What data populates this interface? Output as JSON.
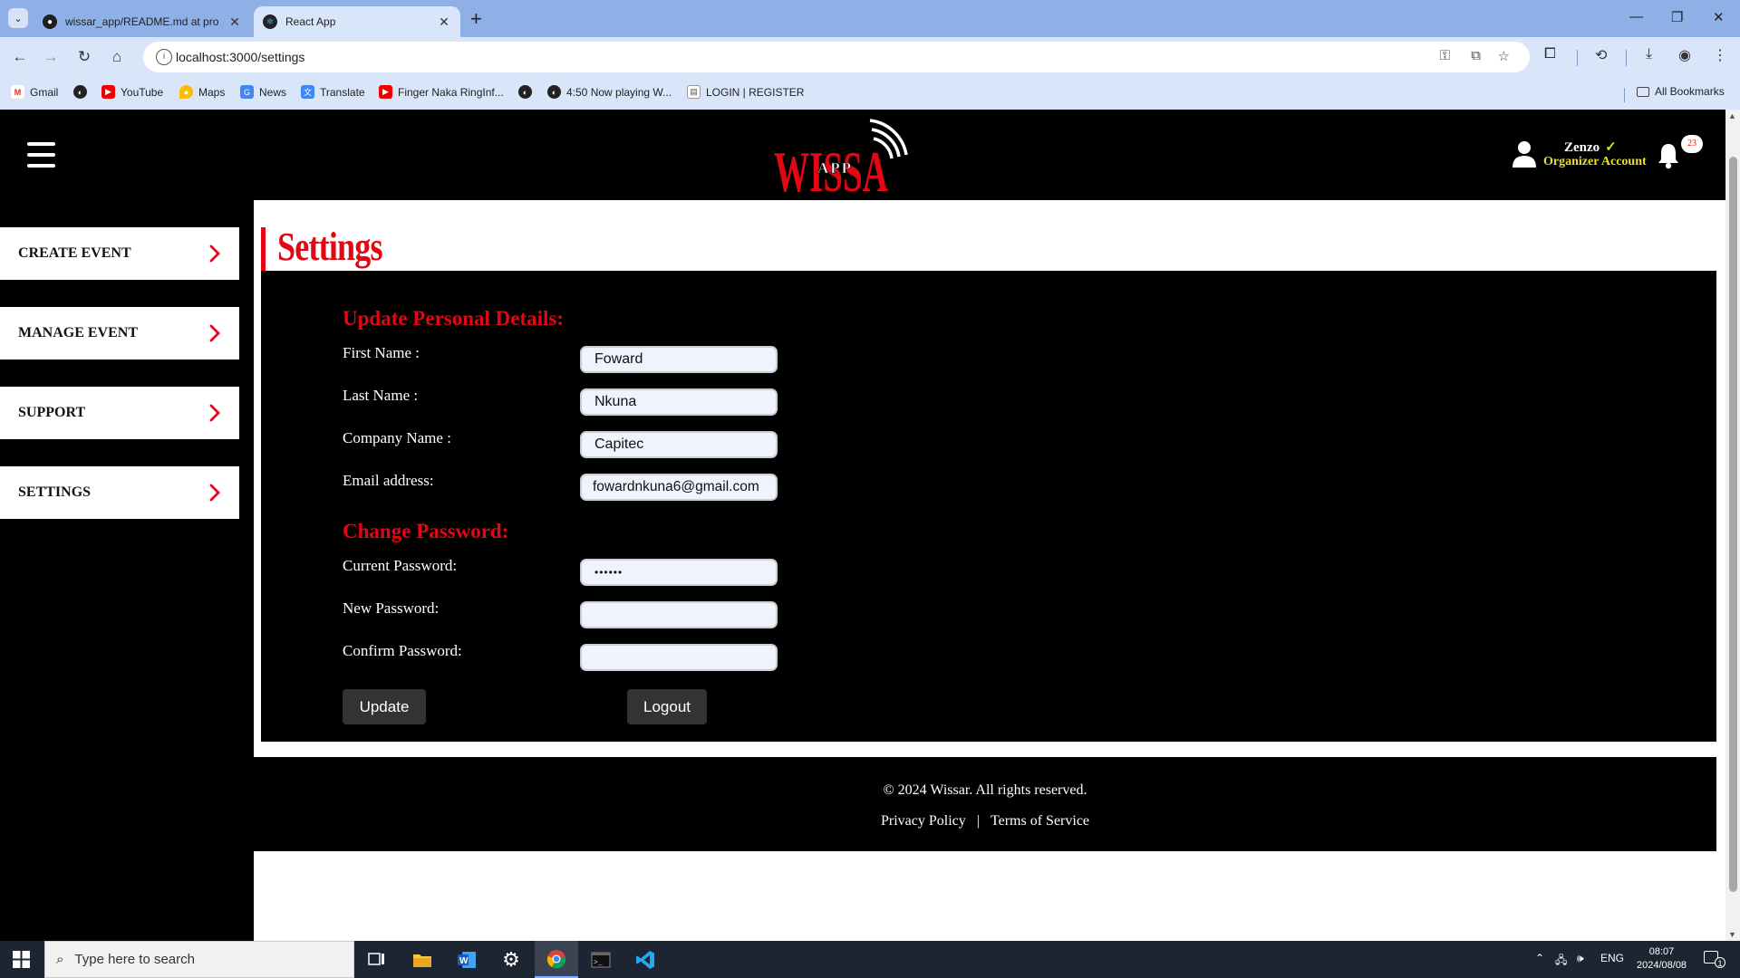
{
  "browser": {
    "tabs": [
      {
        "title": "wissar_app/README.md at pro"
      },
      {
        "title": "React App"
      }
    ],
    "url": "localhost:3000/settings",
    "bookmarks": [
      {
        "label": "Gmail"
      },
      {
        "label": ""
      },
      {
        "label": "YouTube"
      },
      {
        "label": "Maps"
      },
      {
        "label": "News"
      },
      {
        "label": "Translate"
      },
      {
        "label": "Finger Naka RingInf..."
      },
      {
        "label": ""
      },
      {
        "label": "4:50 Now playing W..."
      },
      {
        "label": "LOGIN | REGISTER"
      }
    ],
    "all_bookmarks": "All Bookmarks"
  },
  "header": {
    "logo_text": "WISSA",
    "logo_sub": "APP",
    "user_name": "Zenzo",
    "user_role": "Organizer Account",
    "notification_count": "23"
  },
  "sidebar": {
    "items": [
      {
        "label": "CREATE EVENT"
      },
      {
        "label": "MANAGE EVENT"
      },
      {
        "label": "SUPPORT"
      },
      {
        "label": "SETTINGS"
      }
    ]
  },
  "main": {
    "title": "Settings",
    "personal": {
      "heading": "Update Personal Details:",
      "first_name_label": "First Name :",
      "first_name": "Foward",
      "last_name_label": "Last Name :",
      "last_name": "Nkuna",
      "company_label": "Company Name :",
      "company": "Capitec",
      "email_label": "Email address:",
      "email": "fowardnkuna6@gmail.com"
    },
    "password": {
      "heading": "Change Password:",
      "current_label": "Current Password:",
      "current_value": "••••••",
      "new_label": "New Password:",
      "new_value": "",
      "confirm_label": "Confirm Password:",
      "confirm_value": ""
    },
    "update_label": "Update",
    "logout_label": "Logout"
  },
  "footer": {
    "copyright": "© 2024 Wissar. All rights reserved.",
    "privacy": "Privacy Policy",
    "separator": "|",
    "terms": "Terms of Service"
  },
  "taskbar": {
    "search_placeholder": "Type here to search",
    "language": "ENG",
    "time": "08:07",
    "date": "2024/08/08",
    "notif_count": "1"
  },
  "colors": {
    "accent_red": "#e30613",
    "role_yellow": "#e8df2a",
    "panel_black": "#000000"
  }
}
